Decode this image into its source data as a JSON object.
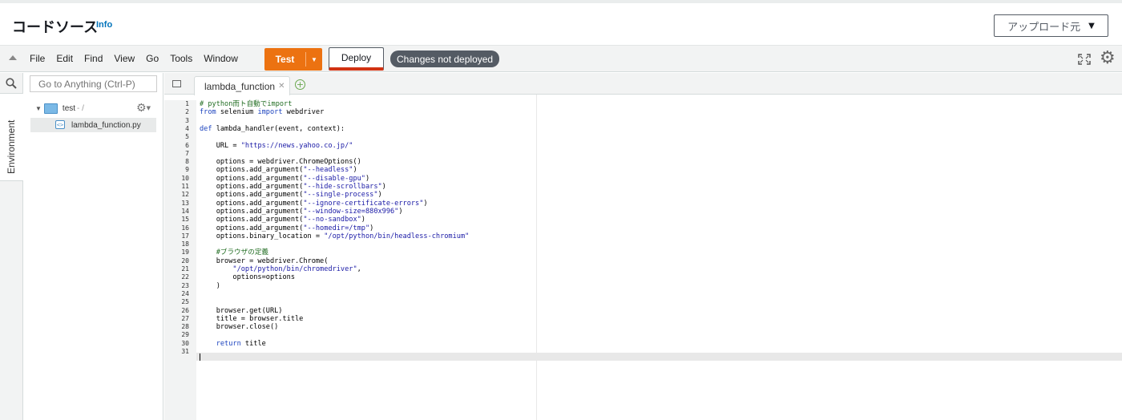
{
  "header": {
    "title": "コードソース",
    "info_label": "Info",
    "upload_label": "アップロード元"
  },
  "toolbar": {
    "menu": [
      "File",
      "Edit",
      "Find",
      "View",
      "Go",
      "Tools",
      "Window"
    ],
    "test_label": "Test",
    "deploy_label": "Deploy",
    "status_badge": "Changes not deployed"
  },
  "sidebar": {
    "environment_label": "Environment",
    "goto_placeholder": "Go to Anything (Ctrl-P)",
    "root_folder": "test",
    "root_suffix": "- /",
    "file": "lambda_function.py"
  },
  "editor": {
    "tab_label": "lambda_function",
    "lines": [
      [
        [
          "c-comment",
          "# python而ト自動でimport"
        ]
      ],
      [
        [
          "c-kw",
          "from"
        ],
        [
          "",
          " selenium "
        ],
        [
          "c-kw",
          "import"
        ],
        [
          "",
          " webdriver"
        ]
      ],
      [],
      [
        [
          "c-kw",
          "def"
        ],
        [
          "",
          " lambda_handler(event, context):"
        ]
      ],
      [],
      [
        [
          "",
          "    URL = "
        ],
        [
          "c-str",
          "\"https://news.yahoo.co.jp/\""
        ]
      ],
      [],
      [
        [
          "",
          "    options = webdriver.ChromeOptions()"
        ]
      ],
      [
        [
          "",
          "    options.add_argument("
        ],
        [
          "c-str",
          "\"--headless\""
        ],
        [
          "",
          ")"
        ]
      ],
      [
        [
          "",
          "    options.add_argument("
        ],
        [
          "c-str",
          "\"--disable-gpu\""
        ],
        [
          "",
          ")"
        ]
      ],
      [
        [
          "",
          "    options.add_argument("
        ],
        [
          "c-str",
          "\"--hide-scrollbars\""
        ],
        [
          "",
          ")"
        ]
      ],
      [
        [
          "",
          "    options.add_argument("
        ],
        [
          "c-str",
          "\"--single-process\""
        ],
        [
          "",
          ")"
        ]
      ],
      [
        [
          "",
          "    options.add_argument("
        ],
        [
          "c-str",
          "\"--ignore-certificate-errors\""
        ],
        [
          "",
          ")"
        ]
      ],
      [
        [
          "",
          "    options.add_argument("
        ],
        [
          "c-str",
          "\"--window-size=880x996\""
        ],
        [
          "",
          ")"
        ]
      ],
      [
        [
          "",
          "    options.add_argument("
        ],
        [
          "c-str",
          "\"--no-sandbox\""
        ],
        [
          "",
          ")"
        ]
      ],
      [
        [
          "",
          "    options.add_argument("
        ],
        [
          "c-str",
          "\"--homedir=/tmp\""
        ],
        [
          "",
          ")"
        ]
      ],
      [
        [
          "",
          "    options.binary_location = "
        ],
        [
          "c-str",
          "\"/opt/python/bin/headless-chromium\""
        ]
      ],
      [],
      [
        [
          "c-comment",
          "    #ブラウザの定義"
        ]
      ],
      [
        [
          "",
          "    browser = webdriver.Chrome("
        ]
      ],
      [
        [
          "",
          "        "
        ],
        [
          "c-str",
          "\"/opt/python/bin/chromedriver\""
        ],
        [
          "",
          ","
        ]
      ],
      [
        [
          "",
          "        options=options"
        ]
      ],
      [
        [
          "",
          "    )"
        ]
      ],
      [],
      [],
      [
        [
          "",
          "    browser.get(URL)"
        ]
      ],
      [
        [
          "",
          "    title = browser.title"
        ]
      ],
      [
        [
          "",
          "    browser.close()"
        ]
      ],
      [],
      [
        [
          "",
          "    "
        ],
        [
          "c-kw",
          "return"
        ],
        [
          "",
          " title"
        ]
      ],
      []
    ]
  }
}
